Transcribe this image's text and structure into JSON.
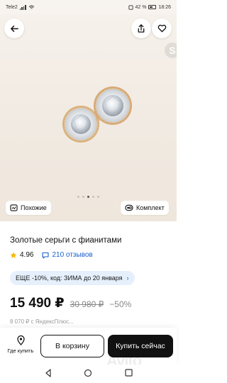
{
  "status_bar": {
    "carrier": "Tele2",
    "battery": "42 %",
    "time": "18:26"
  },
  "gallery": {
    "image_count": 5,
    "active_index": 2,
    "badge": "S",
    "similar_label": "Похожие",
    "set_label": "Комплект",
    "icons": [
      "back-arrow-icon",
      "share-icon",
      "heart-icon",
      "similar-icon",
      "set-icon"
    ]
  },
  "product": {
    "title": "Золотые серьги с фианитами",
    "rating": "4.96",
    "reviews": "210 отзывов",
    "promo": "ЕЩЕ -10%, код: ЗИМА до 20 января",
    "price": "15 490 ₽",
    "old_price": "30 980 ₽",
    "discount": "−50%",
    "next_line": "8 070 ₽ с ЯндексПлюс..."
  },
  "actions": {
    "where_label": "Где купить",
    "cart_label": "В корзину",
    "buy_label": "Купить сейчас"
  },
  "watermark": "Avito",
  "colors": {
    "accent_blue": "#1a5fd1",
    "promo_bg": "#e6f0fc",
    "star": "#f5b800"
  }
}
